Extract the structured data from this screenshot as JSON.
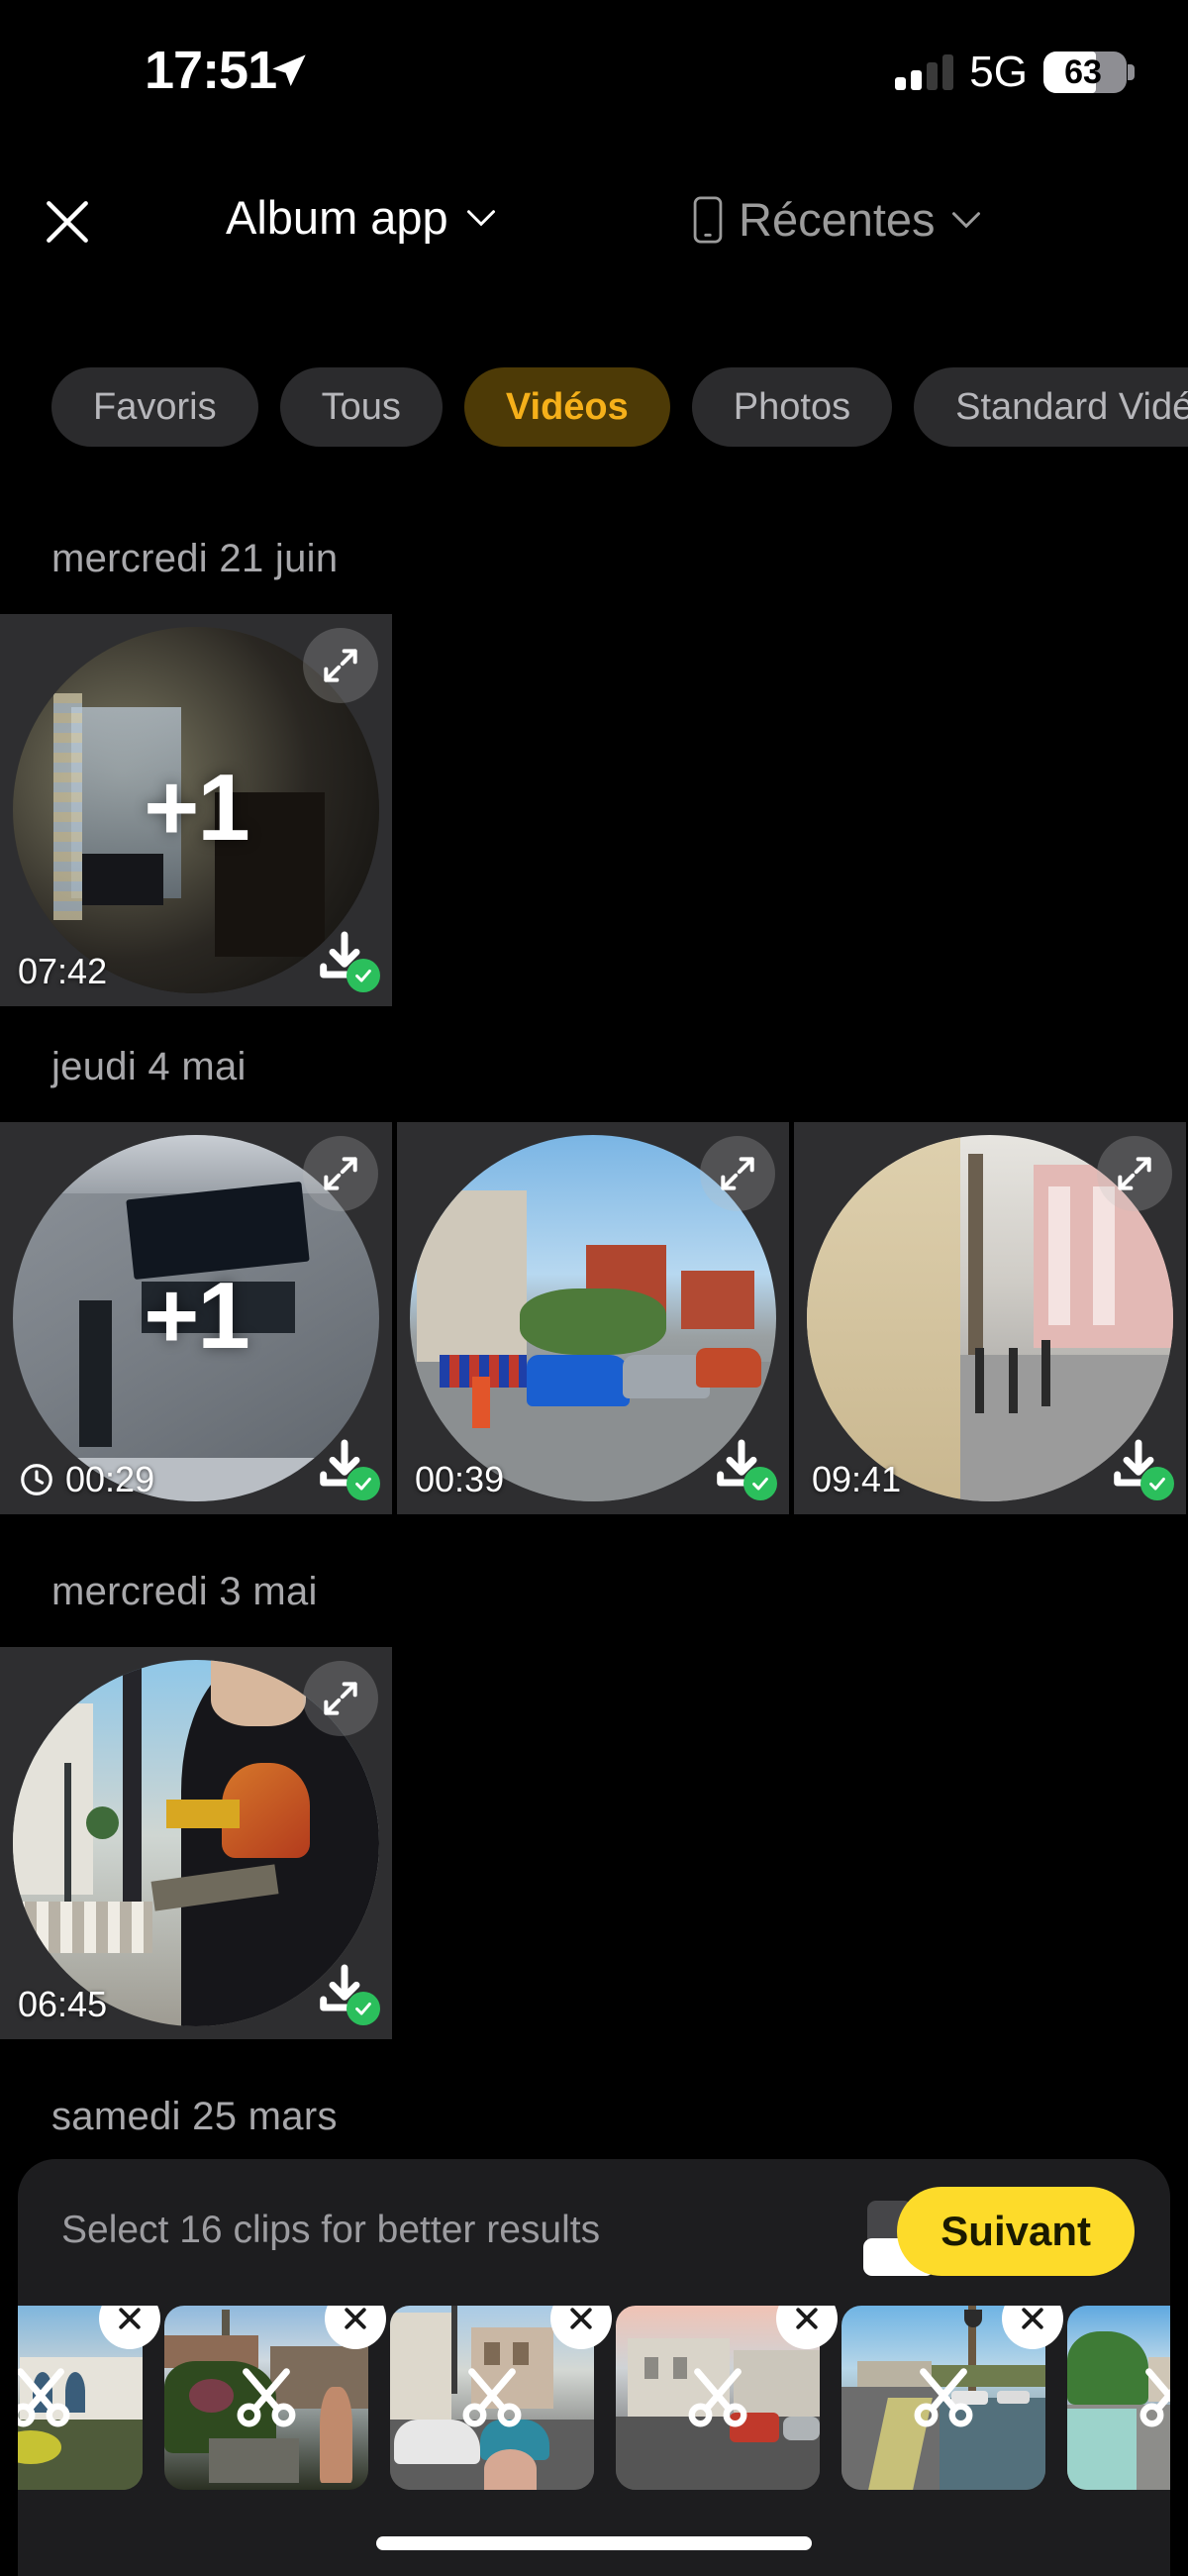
{
  "status_bar": {
    "time": "17:51",
    "location_icon": "location-arrow-icon",
    "signal_icon": "cellular-signal-icon",
    "signal_bars_filled": 2,
    "signal_bars_total": 4,
    "network": "5G",
    "battery_percent": "63",
    "battery_level": 63
  },
  "header": {
    "close_icon": "close-icon",
    "album_label": "Album app",
    "album_chevron_icon": "chevron-down-icon",
    "source_device_icon": "phone-icon",
    "source_label": "Récentes",
    "source_chevron_icon": "chevron-down-icon"
  },
  "filters": {
    "chips": [
      {
        "label": "Favoris",
        "active": false
      },
      {
        "label": "Tous",
        "active": false
      },
      {
        "label": "Vidéos",
        "active": true
      },
      {
        "label": "Photos",
        "active": false
      },
      {
        "label": "Standard Vidéo",
        "active": false
      }
    ],
    "active_bg": "#4d3a06",
    "active_fg": "#f5b01a"
  },
  "gallery": {
    "sections": [
      {
        "date": "mercredi 21 juin",
        "items": [
          {
            "duration": "07:42",
            "plus_badge": "+1",
            "has_clock_icon": false,
            "downloaded": true,
            "expand_icon": "expand-icon",
            "download_icon": "download-check-icon",
            "scene": "dark-living-room"
          }
        ]
      },
      {
        "date": "jeudi 4 mai",
        "items": [
          {
            "duration": "00:29",
            "plus_badge": "+1",
            "has_clock_icon": true,
            "clock_icon": "timer-icon",
            "downloaded": true,
            "expand_icon": "expand-icon",
            "download_icon": "download-check-icon",
            "scene": "grey-building-sign"
          },
          {
            "duration": "00:39",
            "plus_badge": "",
            "has_clock_icon": false,
            "downloaded": true,
            "expand_icon": "expand-icon",
            "download_icon": "download-check-icon",
            "scene": "blue-car-parking"
          },
          {
            "duration": "09:41",
            "plus_badge": "",
            "has_clock_icon": false,
            "downloaded": true,
            "expand_icon": "expand-icon",
            "download_icon": "download-check-icon",
            "scene": "city-street-wall"
          }
        ]
      },
      {
        "date": "mercredi 3 mai",
        "items": [
          {
            "duration": "06:45",
            "plus_badge": "",
            "has_clock_icon": false,
            "downloaded": true,
            "expand_icon": "expand-icon",
            "download_icon": "download-check-icon",
            "scene": "man-with-phone"
          }
        ]
      },
      {
        "date": "samedi 25 mars",
        "items": []
      }
    ]
  },
  "bottom_bar": {
    "hint": "Select 16 clips for better results",
    "stack_icon": "clip-stack-icon",
    "badge_color": "#ef2b2b",
    "next_label": "Suivant",
    "next_bg": "#fddb2a",
    "selected_clips": [
      {
        "remove_icon": "close-icon",
        "trim_icon": "scissors-icon",
        "scene": "white-house-chimney"
      },
      {
        "remove_icon": "close-icon",
        "trim_icon": "scissors-icon",
        "scene": "garden-swing-church"
      },
      {
        "remove_icon": "close-icon",
        "trim_icon": "scissors-icon",
        "scene": "parked-cars-street"
      },
      {
        "remove_icon": "close-icon",
        "trim_icon": "scissors-icon",
        "scene": "sunset-town-square"
      },
      {
        "remove_icon": "close-icon",
        "trim_icon": "scissors-icon",
        "scene": "riverside-road"
      },
      {
        "remove_icon": "close-icon",
        "trim_icon": "scissors-icon",
        "scene": "canal-bridge-walk"
      }
    ]
  },
  "home_indicator": "home-indicator"
}
